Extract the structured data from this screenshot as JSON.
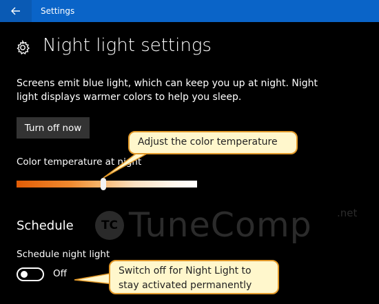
{
  "window": {
    "app_title": "Settings",
    "accent_color": "#0a64c8"
  },
  "header": {
    "title": "Night light settings",
    "icon": "gear-icon"
  },
  "description": "Screens emit blue light, which can keep you up at night. Night light displays warmer colors to help you sleep.",
  "turn_off_button": {
    "label": "Turn off now"
  },
  "color_temperature": {
    "label": "Color temperature at night",
    "slider_value_fraction": 0.48,
    "gradient_colors": [
      "#e25d06",
      "#f08a30",
      "#fbe0c0",
      "#ffffff"
    ]
  },
  "schedule": {
    "heading": "Schedule",
    "label": "Schedule night light",
    "toggle_state": "Off"
  },
  "annotations": {
    "slider_callout": "Adjust the color temperature",
    "toggle_callout": "Switch off for Night Light to stay activated permanently",
    "callout_fill": "#fff7cc",
    "callout_border": "#e39a2a"
  },
  "watermark": {
    "badge": "TC",
    "brand": "TuneComp",
    "suffix": ".net"
  }
}
